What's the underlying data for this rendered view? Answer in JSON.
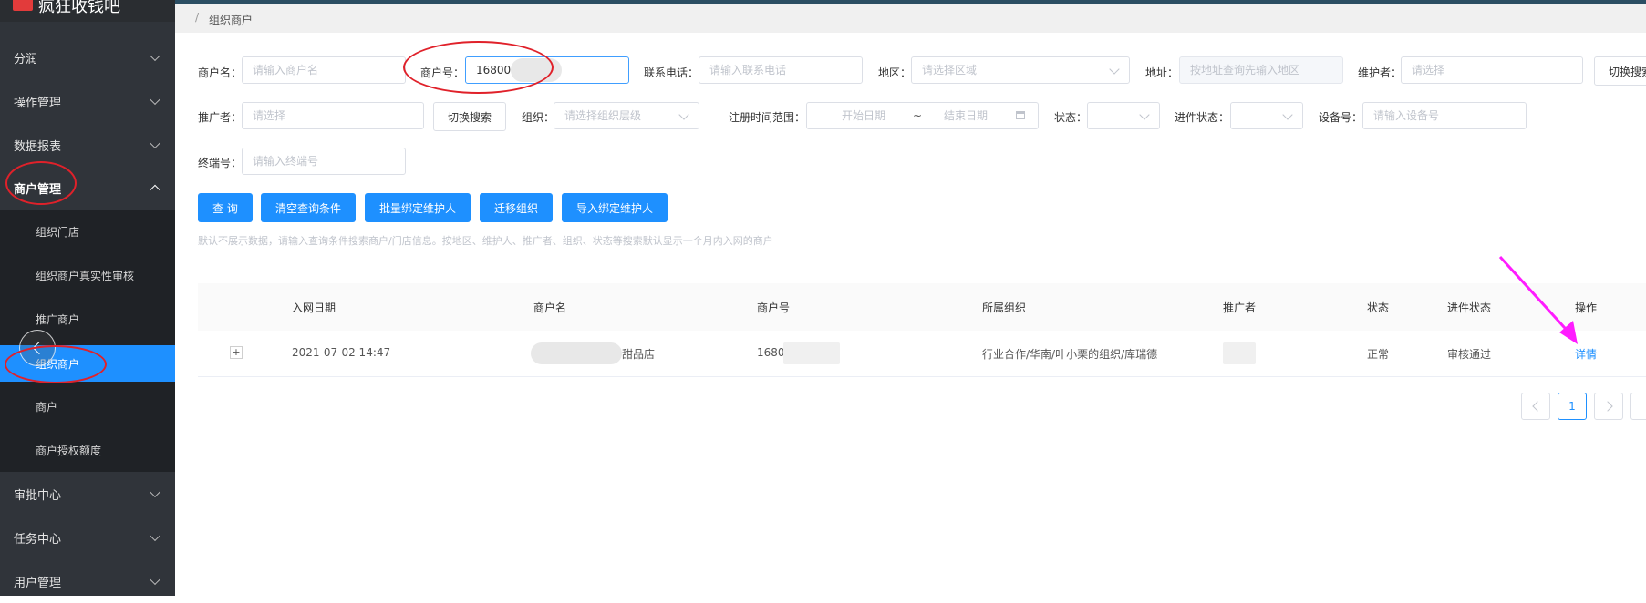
{
  "app": {
    "brand_text": "疯狂收钱吧"
  },
  "breadcrumb": {
    "separator": "/",
    "current": "组织商户"
  },
  "sidebar": {
    "menu": [
      {
        "label": "分润"
      },
      {
        "label": "操作管理"
      },
      {
        "label": "数据报表"
      },
      {
        "label": "商户管理"
      },
      {
        "label": "审批中心"
      },
      {
        "label": "任务中心"
      },
      {
        "label": "用户管理"
      }
    ],
    "submenu": [
      {
        "label": "组织门店"
      },
      {
        "label": "组织商户真实性审核"
      },
      {
        "label": "推广商户"
      },
      {
        "label": "组织商户"
      },
      {
        "label": "商户"
      },
      {
        "label": "商户授权额度"
      }
    ]
  },
  "filters": {
    "merchant_name": {
      "label": "商户名：",
      "placeholder": "请输入商户名"
    },
    "merchant_no": {
      "label": "商户号：",
      "value": "168000"
    },
    "phone": {
      "label": "联系电话：",
      "placeholder": "请输入联系电话"
    },
    "region": {
      "label": "地区：",
      "placeholder": "请选择区域"
    },
    "address": {
      "label": "地址：",
      "placeholder": "按地址查询先输入地区"
    },
    "maintainer": {
      "label": "维护者：",
      "placeholder": "请选择"
    },
    "switch_search_1": "切换搜索",
    "promoter": {
      "label": "推广者：",
      "placeholder": "请选择"
    },
    "switch_search_2": "切换搜索",
    "org": {
      "label": "组织：",
      "placeholder": "请选择组织层级"
    },
    "reg_range": {
      "label": "注册时间范围：",
      "start": "开始日期",
      "sep": "~",
      "end": "结束日期"
    },
    "status": {
      "label": "状态："
    },
    "entry_status": {
      "label": "进件状态："
    },
    "device_no": {
      "label": "设备号：",
      "placeholder": "请输入设备号"
    },
    "terminal_no": {
      "label": "终端号：",
      "placeholder": "请输入终端号"
    }
  },
  "actions": {
    "query": "查 询",
    "clear": "清空查询条件",
    "batch_bind": "批量绑定维护人",
    "migrate": "迁移组织",
    "import_bind": "导入绑定维护人"
  },
  "hint": "默认不展示数据，请输入查询条件搜索商户/门店信息。按地区、维护人、推广者、组织、状态等搜索默认显示一个月内入网的商户",
  "table": {
    "columns": [
      "入网日期",
      "商户名",
      "商户号",
      "所属组织",
      "推广者",
      "状态",
      "进件状态",
      "操作"
    ],
    "rows": [
      {
        "expand": "+",
        "date": "2021-07-02 14:47",
        "name": "甜品店",
        "merchant_no": "1680",
        "org": "行业合作/华南/叶小栗的组织/库瑞德",
        "status": "正常",
        "entry_status": "审核通过",
        "action": "详情"
      }
    ]
  },
  "pagination": {
    "current": "1"
  },
  "colors": {
    "primary": "#1e90ff",
    "sidebar": "#30343a",
    "annotation_red": "#e0212a",
    "annotation_magenta": "#ff1cff"
  }
}
